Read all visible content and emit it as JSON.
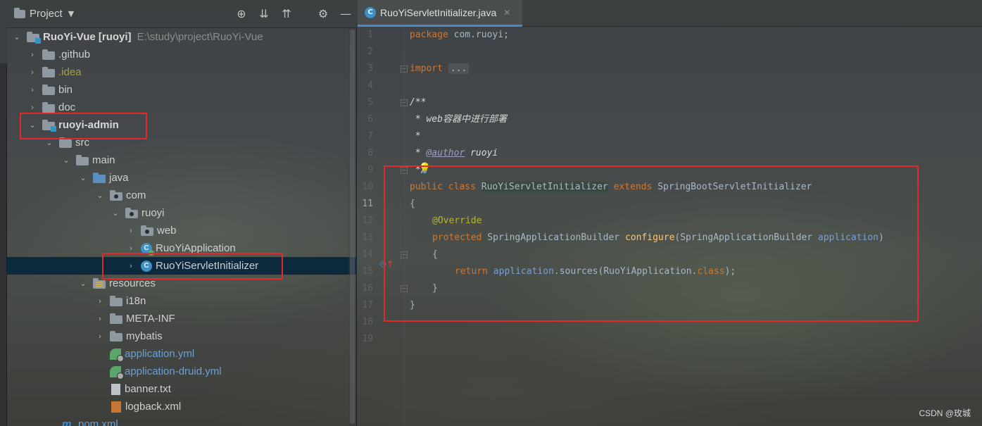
{
  "project_panel": {
    "title": "Project",
    "tree": [
      {
        "name": "RuoYi-Vue [ruoyi]",
        "path": "E:\\study\\project\\RuoYi-Vue",
        "expanded": true
      },
      {
        "name": ".github"
      },
      {
        "name": ".idea"
      },
      {
        "name": "bin"
      },
      {
        "name": "doc"
      },
      {
        "name": "ruoyi-admin",
        "expanded": true
      },
      {
        "name": "src",
        "expanded": true
      },
      {
        "name": "main",
        "expanded": true
      },
      {
        "name": "java",
        "expanded": true
      },
      {
        "name": "com",
        "expanded": true
      },
      {
        "name": "ruoyi",
        "expanded": true
      },
      {
        "name": "web"
      },
      {
        "name": "RuoYiApplication"
      },
      {
        "name": "RuoYiServletInitializer",
        "selected": true
      },
      {
        "name": "resources",
        "expanded": true
      },
      {
        "name": "i18n"
      },
      {
        "name": "META-INF"
      },
      {
        "name": "mybatis"
      },
      {
        "name": "application.yml"
      },
      {
        "name": "application-druid.yml"
      },
      {
        "name": "banner.txt"
      },
      {
        "name": "logback.xml"
      },
      {
        "name": "pom.xml"
      }
    ]
  },
  "editor": {
    "tab_label": "RuoYiServletInitializer.java",
    "current_line": 11,
    "lines": [
      {
        "n": "1"
      },
      {
        "n": "2"
      },
      {
        "n": "3"
      },
      {
        "n": "4"
      },
      {
        "n": "5"
      },
      {
        "n": "6"
      },
      {
        "n": "7"
      },
      {
        "n": "8"
      },
      {
        "n": "9"
      },
      {
        "n": "10"
      },
      {
        "n": "11"
      },
      {
        "n": "12"
      },
      {
        "n": "13"
      },
      {
        "n": "14"
      },
      {
        "n": "15"
      },
      {
        "n": "16"
      },
      {
        "n": "17"
      },
      {
        "n": "18"
      },
      {
        "n": "19"
      }
    ],
    "code": {
      "l1_kw": "package",
      "l1_rest": " com.ruoyi;",
      "l3_kw": "import",
      "l3_fold": "...",
      "l6": "/**",
      "l7": " * web容器中进行部署",
      "l8": " *",
      "l9_pre": " * ",
      "l9_tag": "@author",
      "l9_post": " ruoyi",
      "l10": " */",
      "l11_kw1": "public class",
      "l11_cls": "RuoYiServletInitializer",
      "l11_kw2": "extends",
      "l11_super": "SpringBootServletInitializer",
      "l12": "{",
      "l13": "@Override",
      "l14_kw": "protected",
      "l14_type": "SpringApplicationBuilder",
      "l14_method": "configure",
      "l14_ptype": "SpringApplicationBuilder",
      "l14_param": "application",
      "l15": "{",
      "l16_kw": "return",
      "l16_obj": "application",
      "l16_call": ".sources(RuoYiApplication.",
      "l16_kw2": "class",
      "l16_end": ");",
      "l17": "}",
      "l18": "}"
    }
  },
  "watermark": "CSDN @玫城"
}
